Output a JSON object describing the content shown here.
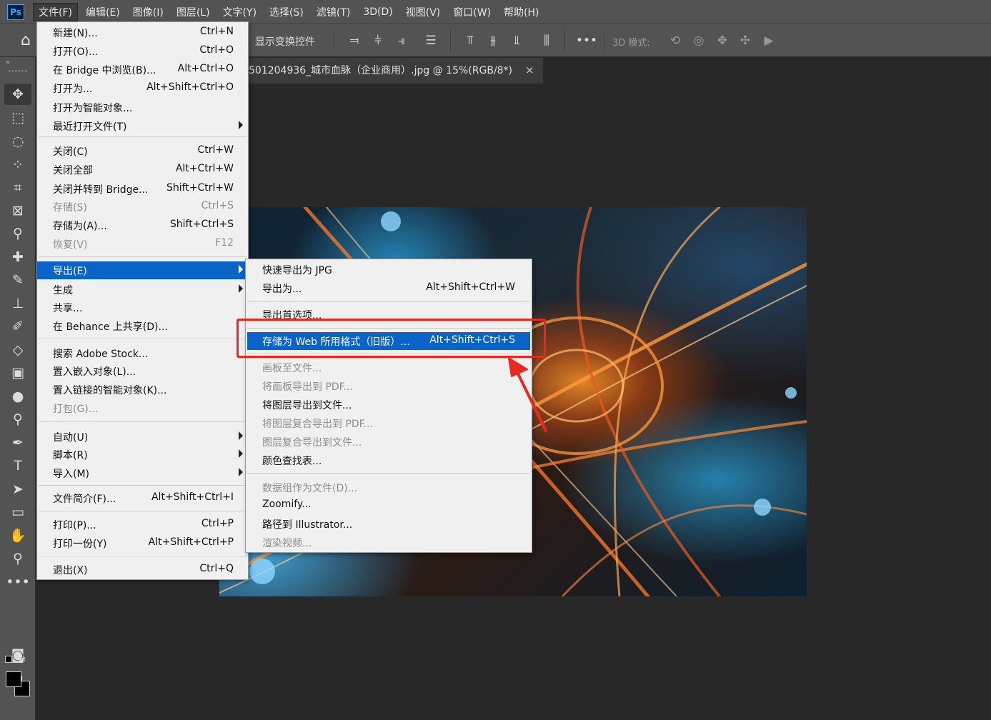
{
  "app": {
    "logo": "Ps"
  },
  "menubar": {
    "items": [
      "文件(F)",
      "编辑(E)",
      "图像(I)",
      "图层(L)",
      "文字(Y)",
      "选择(S)",
      "滤镜(T)",
      "3D(D)",
      "视图(V)",
      "窗口(W)",
      "帮助(H)"
    ],
    "active_index": 0
  },
  "options_bar": {
    "home_icon": "home-icon",
    "show_transform_label": "显示变换控件",
    "more_label": "•••",
    "mode_label": "3D 模式:"
  },
  "document": {
    "tab_title": "501204936_城市血脉（企业商用）.jpg @ 15%(RGB/8*)",
    "close_symbol": "×"
  },
  "file_menu": {
    "items": [
      {
        "label": "新建(N)...",
        "shortcut": "Ctrl+N"
      },
      {
        "label": "打开(O)...",
        "shortcut": "Ctrl+O"
      },
      {
        "label": "在 Bridge 中浏览(B)...",
        "shortcut": "Alt+Ctrl+O"
      },
      {
        "label": "打开为...",
        "shortcut": "Alt+Shift+Ctrl+O"
      },
      {
        "label": "打开为智能对象...",
        "shortcut": ""
      },
      {
        "label": "最近打开文件(T)",
        "shortcut": "",
        "submenu": true
      },
      {
        "label": "关闭(C)",
        "shortcut": "Ctrl+W"
      },
      {
        "label": "关闭全部",
        "shortcut": "Alt+Ctrl+W"
      },
      {
        "label": "关闭并转到 Bridge...",
        "shortcut": "Shift+Ctrl+W"
      },
      {
        "label": "存储(S)",
        "shortcut": "Ctrl+S",
        "disabled": true
      },
      {
        "label": "存储为(A)...",
        "shortcut": "Shift+Ctrl+S"
      },
      {
        "label": "恢复(V)",
        "shortcut": "F12",
        "disabled": true
      },
      {
        "label": "导出(E)",
        "shortcut": "",
        "submenu": true,
        "highlighted": true
      },
      {
        "label": "生成",
        "shortcut": "",
        "submenu": true
      },
      {
        "label": "共享...",
        "shortcut": ""
      },
      {
        "label": "在 Behance 上共享(D)...",
        "shortcut": ""
      },
      {
        "label": "搜索 Adobe Stock...",
        "shortcut": ""
      },
      {
        "label": "置入嵌入对象(L)...",
        "shortcut": ""
      },
      {
        "label": "置入链接的智能对象(K)...",
        "shortcut": ""
      },
      {
        "label": "打包(G)...",
        "shortcut": "",
        "disabled": true
      },
      {
        "label": "自动(U)",
        "shortcut": "",
        "submenu": true
      },
      {
        "label": "脚本(R)",
        "shortcut": "",
        "submenu": true
      },
      {
        "label": "导入(M)",
        "shortcut": "",
        "submenu": true
      },
      {
        "label": "文件简介(F)...",
        "shortcut": "Alt+Shift+Ctrl+I"
      },
      {
        "label": "打印(P)...",
        "shortcut": "Ctrl+P"
      },
      {
        "label": "打印一份(Y)",
        "shortcut": "Alt+Shift+Ctrl+P"
      },
      {
        "label": "退出(X)",
        "shortcut": "Ctrl+Q"
      }
    ]
  },
  "export_menu": {
    "items": [
      {
        "label": "快速导出为 JPG",
        "shortcut": ""
      },
      {
        "label": "导出为...",
        "shortcut": "Alt+Shift+Ctrl+W"
      },
      {
        "label": "导出首选项...",
        "shortcut": ""
      },
      {
        "label": "存储为 Web 所用格式（旧版）...",
        "shortcut": "Alt+Shift+Ctrl+S",
        "highlighted": true
      },
      {
        "label": "画板至文件...",
        "shortcut": "",
        "disabled": true
      },
      {
        "label": "将画板导出到 PDF...",
        "shortcut": "",
        "disabled": true
      },
      {
        "label": "将图层导出到文件...",
        "shortcut": ""
      },
      {
        "label": "将图层复合导出到 PDF...",
        "shortcut": "",
        "disabled": true
      },
      {
        "label": "图层复合导出到文件...",
        "shortcut": "",
        "disabled": true
      },
      {
        "label": "颜色查找表...",
        "shortcut": ""
      },
      {
        "label": "数据组作为文件(D)...",
        "shortcut": "",
        "disabled": true
      },
      {
        "label": "Zoomify...",
        "shortcut": ""
      },
      {
        "label": "路径到 Illustrator...",
        "shortcut": ""
      },
      {
        "label": "渲染视频...",
        "shortcut": "",
        "disabled": true
      }
    ]
  },
  "tools": [
    "move-icon",
    "marquee-icon",
    "lasso-icon",
    "quick-select-icon",
    "crop-icon",
    "frame-icon",
    "eyedropper-icon",
    "healing-icon",
    "brush-icon",
    "stamp-icon",
    "history-brush-icon",
    "eraser-icon",
    "gradient-icon",
    "blur-icon",
    "dodge-icon",
    "pen-icon",
    "type-icon",
    "path-select-icon",
    "rectangle-icon",
    "hand-icon",
    "zoom-icon",
    "more-tools-icon",
    "quick-mask-icon",
    "screen-mode-icon"
  ],
  "colors": {
    "highlight": "#0a64c8",
    "annotation": "#e8291f",
    "foreground": "#000000",
    "background": "#000000"
  }
}
